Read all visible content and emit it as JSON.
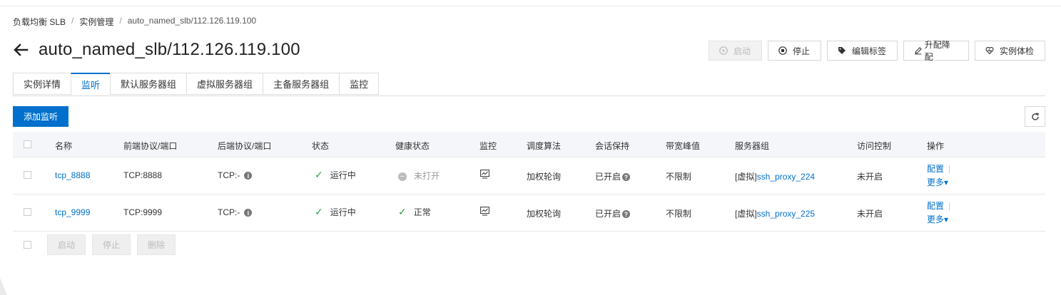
{
  "breadcrumb": {
    "items": [
      "负载均衡 SLB",
      "实例管理",
      "auto_named_slb/112.126.119.100"
    ],
    "sep": "/"
  },
  "title": "auto_named_slb/112.126.119.100",
  "actions": {
    "start": "启动",
    "stop": "停止",
    "edit_tags": "编辑标签",
    "upgrade": "升配降配",
    "health_check": "实例体检"
  },
  "tabs": [
    "实例详情",
    "监听",
    "默认服务器组",
    "虚拟服务器组",
    "主备服务器组",
    "监控"
  ],
  "add_button": "添加监听",
  "table": {
    "headers": [
      "名称",
      "前端协议/端口",
      "后端协议/端口",
      "状态",
      "健康状态",
      "监控",
      "调度算法",
      "会话保持",
      "带宽峰值",
      "服务器组",
      "访问控制",
      "操作"
    ],
    "rows": [
      {
        "name": "tcp_8888",
        "frontend": "TCP:8888",
        "backend": "TCP:-",
        "status": "运行中",
        "health": "未打开",
        "algorithm": "加权轮询",
        "session": "已开启",
        "bandwidth": "不限制",
        "group_prefix": "[虚拟]",
        "group": "ssh_proxy_224",
        "acl": "未开启",
        "op_config": "配置",
        "op_more": "更多▾"
      },
      {
        "name": "tcp_9999",
        "frontend": "TCP:9999",
        "backend": "TCP:-",
        "status": "运行中",
        "health": "正常",
        "algorithm": "加权轮询",
        "session": "已开启",
        "bandwidth": "不限制",
        "group_prefix": "[虚拟]",
        "group": "ssh_proxy_225",
        "acl": "未开启",
        "op_config": "配置",
        "op_more": "更多▾"
      }
    ]
  },
  "footer": {
    "start": "启动",
    "stop": "停止",
    "delete": "删除"
  },
  "colors": {
    "primary": "#0070cc",
    "success": "#2ba245",
    "disabled_bg": "#f2f2f2"
  }
}
